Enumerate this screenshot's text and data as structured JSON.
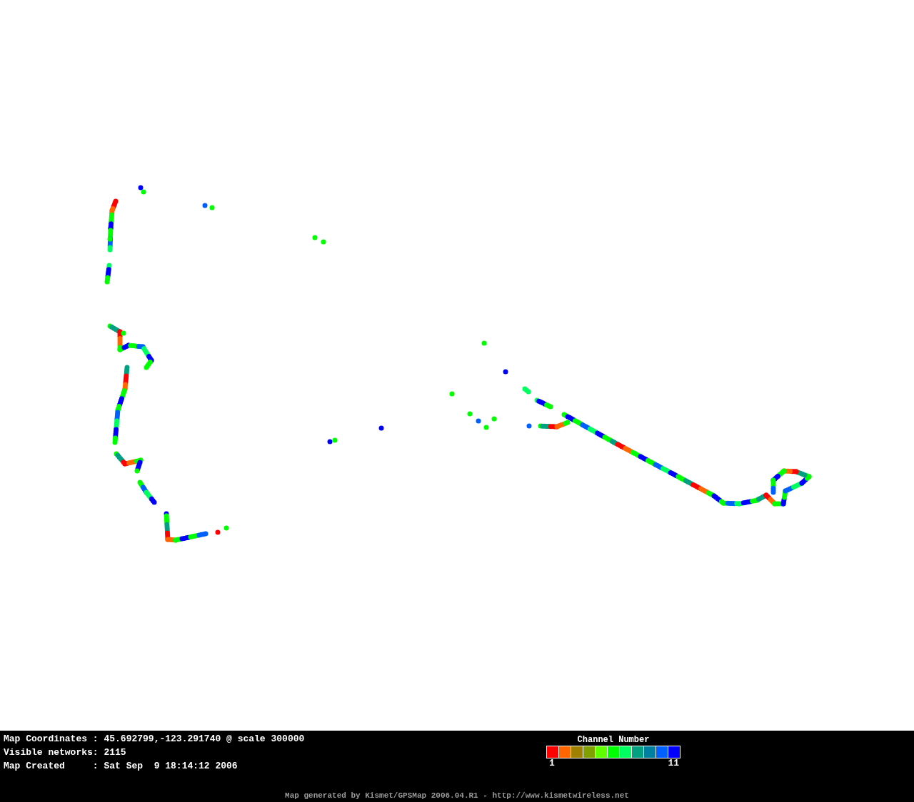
{
  "info": [
    {
      "label": "Map Coordinates :",
      "value": "45.692799,-123.291740 @ scale 300000"
    },
    {
      "label": "Visible networks:",
      "value": "2115"
    },
    {
      "label": "Map Created     :",
      "value": "Sat Sep  9 18:14:12 2006"
    }
  ],
  "legend": {
    "title": "Channel Number",
    "min_label": "1",
    "max_label": "11",
    "swatches": [
      {
        "color": "#ff0000"
      },
      {
        "color": "#ff6600"
      },
      {
        "color": "#a08000"
      },
      {
        "color": "#80a000"
      },
      {
        "color": "#60ff00"
      },
      {
        "color": "#00ff00"
      },
      {
        "color": "#00ff60"
      },
      {
        "color": "#00a080"
      },
      {
        "color": "#0080a0"
      },
      {
        "color": "#0060ff"
      },
      {
        "color": "#0000ff"
      }
    ]
  },
  "credit": "Map generated by Kismet/GPSMap 2006.04.R1 - http://www.kismetwireless.net"
}
